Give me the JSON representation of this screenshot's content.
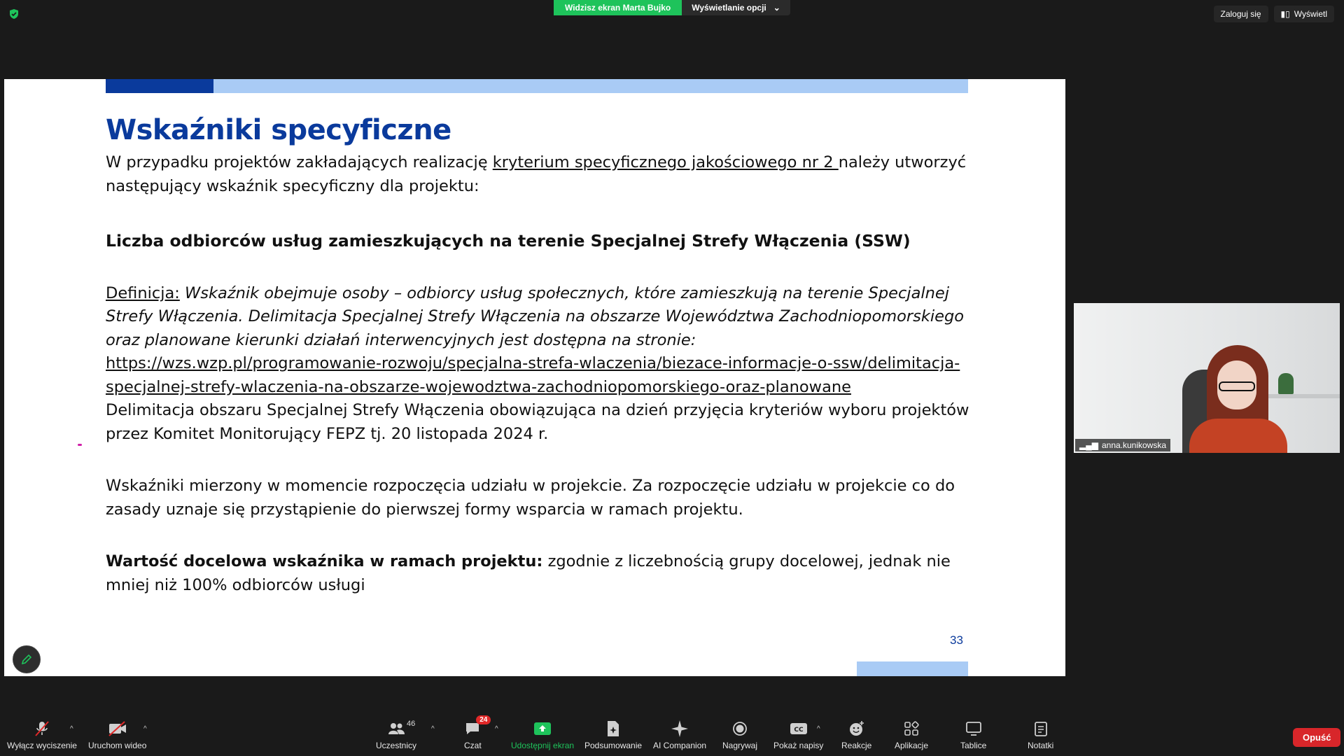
{
  "top": {
    "share_banner": "Widzisz ekran Marta Bujko",
    "view_options": "Wyświetlanie opcji",
    "sign_in": "Zaloguj się",
    "view": "Wyświetl"
  },
  "slide": {
    "title": "Wskaźniki specyficzne",
    "intro_prefix": "W przypadku projektów zakładających realizację ",
    "intro_link": "kryterium specyficznego jakościowego nr 2 ",
    "intro_suffix": "należy utworzyć następujący wskaźnik specyficzny dla projektu:",
    "indicator_name": "Liczba odbiorców usług zamieszkujących na terenie Specjalnej Strefy Włączenia (SSW)",
    "definition_label": "Definicja:",
    "definition_text": " Wskaźnik obejmuje osoby – odbiorcy usług społecznych, które zamieszkują na terenie Specjalnej Strefy Włączenia. Delimitacja Specjalnej Strefy Włączenia na obszarze Województwa Zachodniopomorskiego oraz planowane kierunki działań interwencyjnych jest dostępna na stronie:",
    "definition_url_line1": "https://wzs.wzp.pl/programowanie-rozwoju/specjalna-strefa-wlaczenia/biezace-informacje-o-ssw/delimitacja-",
    "definition_url_line2": "specjalnej-strefy-wlaczenia-na-obszarze-wojewodztwa-zachodniopomorskiego-oraz-planowane",
    "delimitation_note": "Delimitacja obszaru Specjalnej Strefy Włączenia obowiązująca na dzień przyjęcia kryteriów wyboru projektów przez Komitet Monitorujący FEPZ tj. 20 listopada 2024 r.",
    "measurement_note": "Wskaźniki mierzony w momencie rozpoczęcia udziału w projekcie. Za rozpoczęcie udziału w projekcie co do zasady uznaje się przystąpienie do pierwszej formy wsparcia w ramach projektu.",
    "target_label": "Wartość docelowa wskaźnika w ramach projektu:",
    "target_text": " zgodnie z liczebnością grupy docelowej, jednak nie mniej niż 100% odbiorców usługi",
    "page_number": "33"
  },
  "video": {
    "participant_name": "anna.kunikowska"
  },
  "toolbar": {
    "mute": "Wyłącz wyciszenie",
    "video": "Uruchom wideo",
    "participants": "Uczestnicy",
    "participants_count": "46",
    "chat": "Czat",
    "chat_badge": "24",
    "share": "Udostępnij ekran",
    "summary": "Podsumowanie",
    "ai": "AI Companion",
    "record": "Nagrywaj",
    "captions": "Pokaż napisy",
    "reactions": "Reakcje",
    "apps": "Aplikacje",
    "whiteboards": "Tablice",
    "notes": "Notatki",
    "leave": "Opuść"
  },
  "colors": {
    "accent_green": "#1ec35b",
    "slide_blue": "#0a3a9c",
    "slide_light_blue": "#a9cbf5",
    "leave_red": "#d8262a"
  }
}
